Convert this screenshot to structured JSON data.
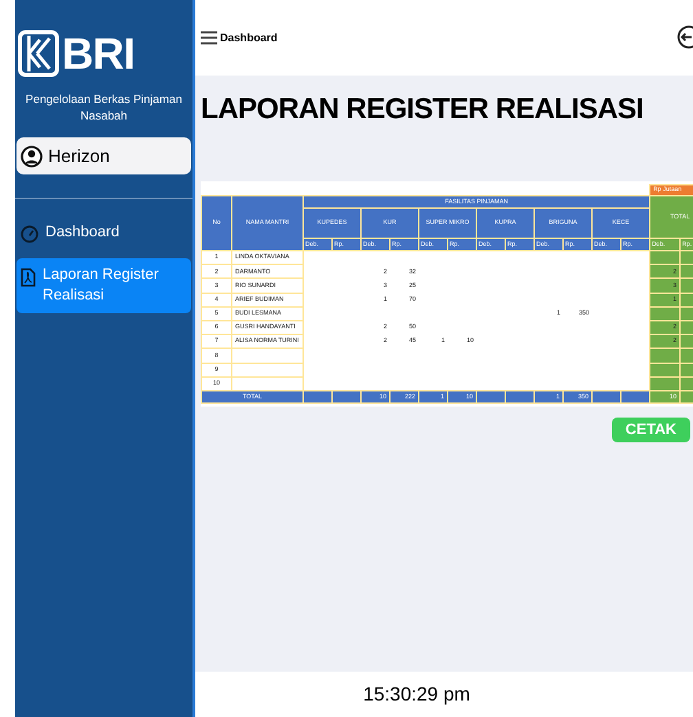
{
  "sidebar": {
    "logo": "BRI",
    "subtitle": "Pengelolaan Berkas Pinjaman Nasabah",
    "user": "Herizon",
    "items": [
      {
        "label": "Dashboard",
        "kind": "dashboard",
        "selected": false
      },
      {
        "label": "Laporan Register Realisasi",
        "kind": "report",
        "selected": true
      }
    ]
  },
  "header": {
    "title": "Dashboard"
  },
  "page_title": "LAPORAN REGISTER REALISASI",
  "table": {
    "no_label": "No",
    "name_label": "NAMA MANTRI",
    "group_label": "FASILITAS PINJAMAN",
    "facilities": [
      {
        "kind": "kupedes",
        "name": "KUPEDES",
        "subs": [
          "Deb.",
          "Rp."
        ]
      },
      {
        "kind": "kur",
        "name": "KUR",
        "subs": [
          "Deb.",
          "Rp."
        ]
      },
      {
        "kind": "super_mikro",
        "name": "SUPER MIKRO",
        "subs": [
          "Deb.",
          "Rp."
        ]
      },
      {
        "kind": "kupra",
        "name": "KUPRA",
        "subs": [
          "Deb.",
          "Rp."
        ]
      },
      {
        "kind": "briguna",
        "name": "BRIGUNA",
        "subs": [
          "Deb.",
          "Rp."
        ]
      },
      {
        "kind": "kece",
        "name": "KECE",
        "subs": [
          "Deb.",
          "Rp."
        ]
      }
    ],
    "total": {
      "label": "TOTAL",
      "unit": "Rp Jutaan",
      "subs": [
        "Deb.",
        "Rp."
      ]
    },
    "rows": [
      {
        "no": "1",
        "name": "LINDA OKTAVIANA"
      },
      {
        "no": "2",
        "name": "DARMANTO",
        "kur": {
          "deb": "2",
          "rp": "32"
        },
        "total": {
          "deb": "2"
        }
      },
      {
        "no": "3",
        "name": "RIO SUNARDI",
        "kur": {
          "deb": "3",
          "rp": "25"
        },
        "total": {
          "deb": "3"
        }
      },
      {
        "no": "4",
        "name": "ARIEF BUDIMAN",
        "kur": {
          "deb": "1",
          "rp": "70"
        },
        "total": {
          "deb": "1"
        }
      },
      {
        "no": "5",
        "name": "BUDI LESMANA",
        "briguna": {
          "deb": "1",
          "rp": "350"
        }
      },
      {
        "no": "6",
        "name": "GUSRI HANDAYANTI",
        "kur": {
          "deb": "2",
          "rp": "50"
        },
        "total": {
          "deb": "2"
        }
      },
      {
        "no": "7",
        "name": "ALISA NORMA TURINI",
        "kur": {
          "deb": "2",
          "rp": "45"
        },
        "super_mikro": {
          "deb": "1",
          "rp": "10"
        },
        "total": {
          "deb": "2"
        }
      },
      {
        "no": "8"
      },
      {
        "no": "9"
      },
      {
        "no": "10"
      }
    ],
    "total_row": {
      "label": "TOTAL",
      "kur": {
        "deb": "10",
        "rp": "222"
      },
      "super_mikro": {
        "deb": "1",
        "rp": "10"
      },
      "briguna": {
        "deb": "1",
        "rp": "350"
      },
      "total": {
        "deb": "10"
      }
    }
  },
  "print_button": "CETAK",
  "footer": {
    "time": "15:30:29 pm"
  }
}
